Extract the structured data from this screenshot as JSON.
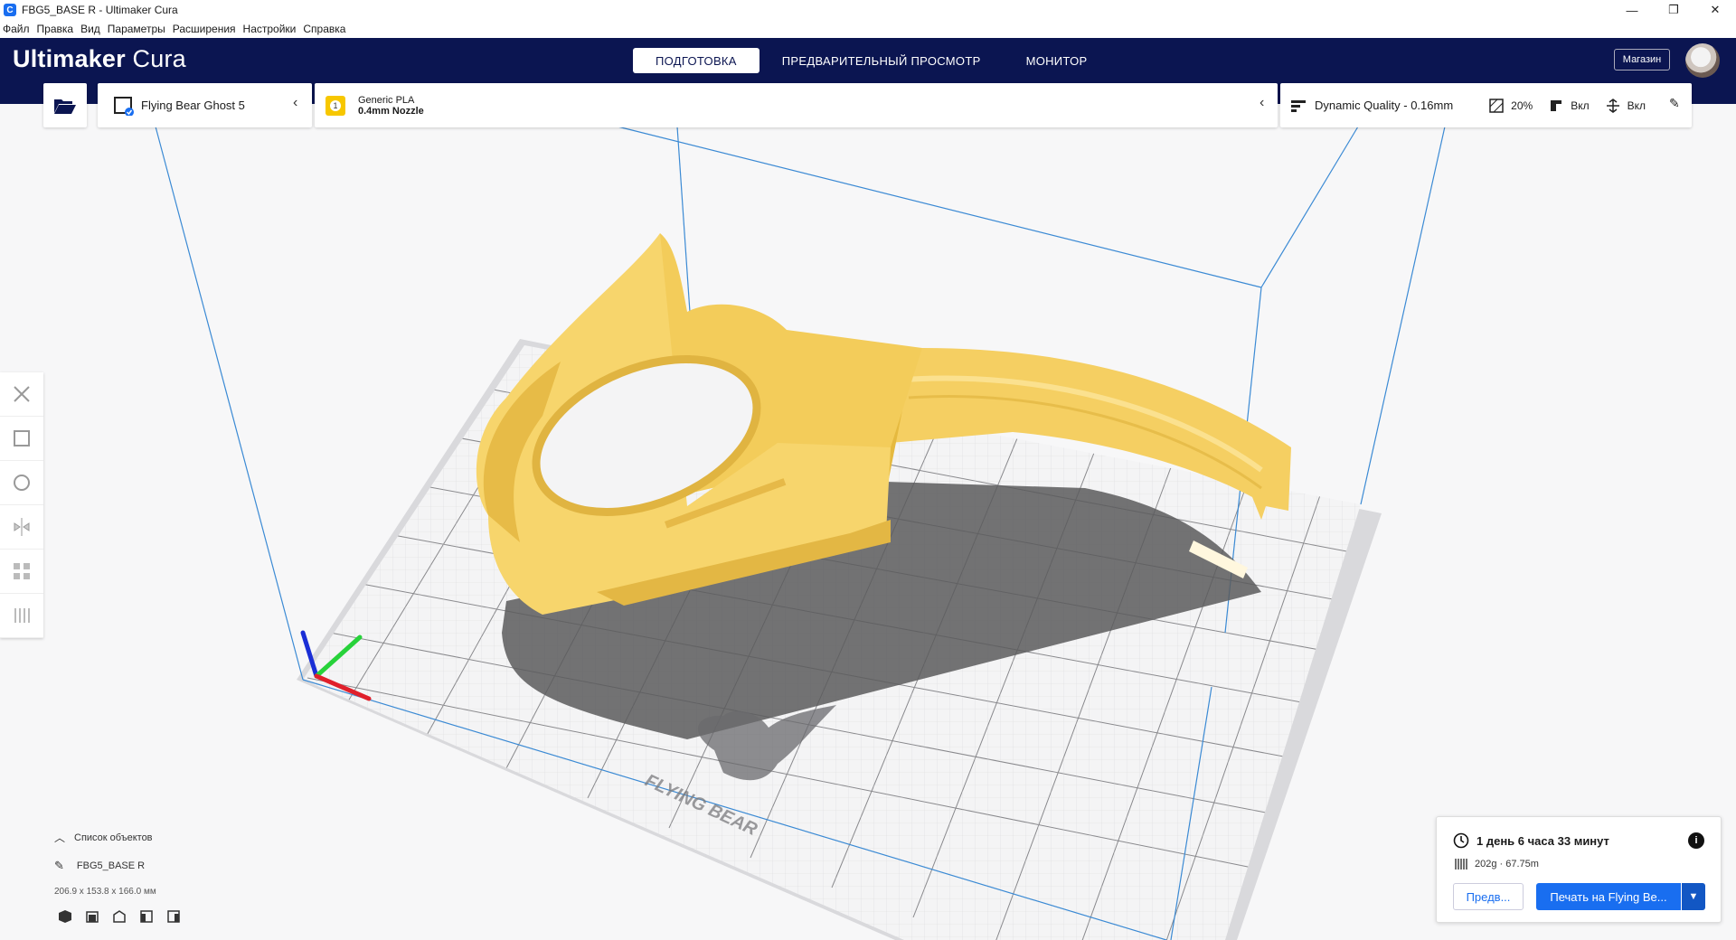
{
  "window": {
    "title": "FBG5_BASE R - Ultimaker Cura"
  },
  "menu": [
    "Файл",
    "Правка",
    "Вид",
    "Параметры",
    "Расширения",
    "Настройки",
    "Справка"
  ],
  "header": {
    "logo_brand": "Ultimaker",
    "logo_product": " Cura",
    "stages": [
      "ПОДГОТОВКА",
      "ПРЕДВАРИТЕЛЬНЫЙ ПРОСМОТР",
      "МОНИТОР"
    ],
    "marketplace": "Магазин"
  },
  "printer": {
    "name": "Flying Bear Ghost 5"
  },
  "material": {
    "extruder": "1",
    "name": "Generic PLA",
    "nozzle": "0.4mm Nozzle"
  },
  "print_settings": {
    "profile": "Dynamic Quality - 0.16mm",
    "infill": "20%",
    "support": "Вкл",
    "adhesion": "Вкл"
  },
  "objects": {
    "header": "Список объектов",
    "name": "FBG5_BASE R",
    "dimensions": "206.9 x 153.8 x 166.0 мм"
  },
  "print_info": {
    "time": "1 день 6 часа 33 минут",
    "material": "202g · 67.75m",
    "preview_button": "Предв...",
    "print_button": "Печать на Flying Be..."
  },
  "colors": {
    "header_bg": "#0b1551",
    "accent": "#196ef0",
    "model": "#f7d46b",
    "badge": "#f7c700"
  },
  "icons": [
    "folder-open-icon",
    "printer-icon",
    "chevron-left-icon",
    "profile-icon",
    "infill-icon",
    "support-icon",
    "adhesion-icon",
    "pencil-icon",
    "move-icon",
    "scale-icon",
    "rotate-icon",
    "mirror-icon",
    "per-model-settings-icon",
    "support-blocker-icon",
    "clock-icon",
    "spool-icon",
    "info-icon",
    "chevron-down-icon"
  ],
  "buildplate_logo": "FLYING BEAR"
}
